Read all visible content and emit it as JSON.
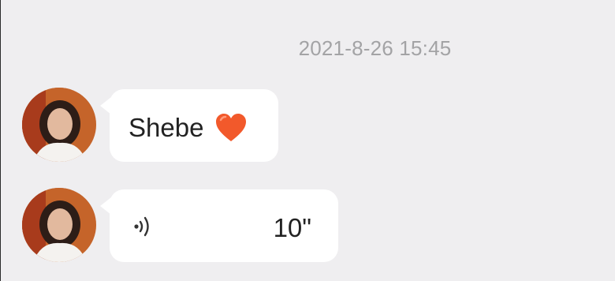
{
  "timestamp": "2021-8-26 15:45",
  "messages": [
    {
      "type": "text",
      "text": "Shebe",
      "emoji": "heart-icon"
    },
    {
      "type": "voice",
      "duration": "10\""
    }
  ],
  "colors": {
    "background": "#efeef0",
    "bubble": "#ffffff",
    "timestamp": "#a3a3a5",
    "heart": "#f2592b"
  }
}
